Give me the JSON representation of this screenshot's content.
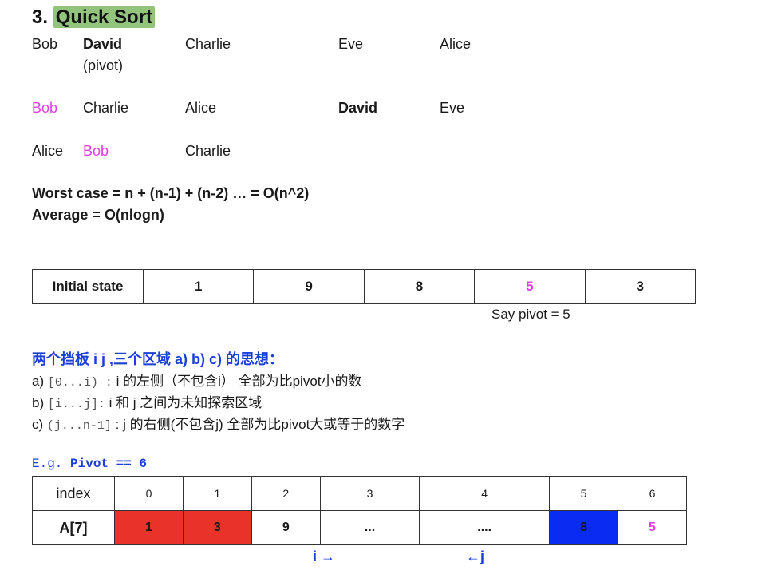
{
  "title": {
    "num": "3. ",
    "text": "Quick Sort"
  },
  "rows": [
    [
      {
        "text": "Bob"
      },
      {
        "text": "David",
        "sub": "(pivot)",
        "style": "bold"
      },
      {
        "text": "Charlie"
      },
      {
        "text": "Eve"
      },
      {
        "text": "Alice"
      }
    ],
    [
      {
        "text": "Bob",
        "style": "magenta"
      },
      {
        "text": "Charlie"
      },
      {
        "text": "Alice"
      },
      {
        "text": "David",
        "style": "bold"
      },
      {
        "text": "Eve"
      }
    ],
    [
      {
        "text": "Alice"
      },
      {
        "text": "Bob",
        "style": "magenta"
      },
      {
        "text": "Charlie"
      }
    ]
  ],
  "complexity": {
    "worst": "Worst case = n + (n-1) + (n-2) …  = O(n^2)",
    "average": "Average = O(nlogn)"
  },
  "state_table": {
    "label": "Initial state",
    "cells": [
      "1",
      "9",
      "8",
      "5",
      "3"
    ],
    "pivot_note": "Say pivot = 5"
  },
  "ideas": {
    "heading": "两个挡板 i j ,三个区域 a) b) c) 的思想：",
    "a": {
      "prefix": "a) ",
      "code": "[0...i) :",
      "text": "  i 的左侧（不包含i） 全部为比pivot小的数"
    },
    "b": {
      "prefix": "b) ",
      "code": "[i...j]:",
      "text": "  i 和 j 之间为未知探索区域"
    },
    "c": {
      "prefix": "c) ",
      "code": "(j...n-1]",
      "text": " : j 的右侧(不包含j) 全部为比pivot大或等于的数字"
    }
  },
  "example": {
    "label": "E.g. ",
    "pivot": "Pivot == 6"
  },
  "array_table": {
    "index_label": "index",
    "indices": [
      "0",
      "1",
      "2",
      "3",
      "4",
      "5",
      "6"
    ],
    "array_label": "A[7]",
    "values": [
      "1",
      "3",
      "9",
      "...",
      "....",
      "8",
      "5"
    ]
  },
  "pointers": {
    "i": "i  →",
    "j": "←j"
  },
  "colors": {
    "highlight": "#93c47d",
    "magenta": "#e040e0",
    "blue": "#1a3fd6",
    "red": "#e9332a",
    "cell_blue": "#0a2bf2"
  }
}
